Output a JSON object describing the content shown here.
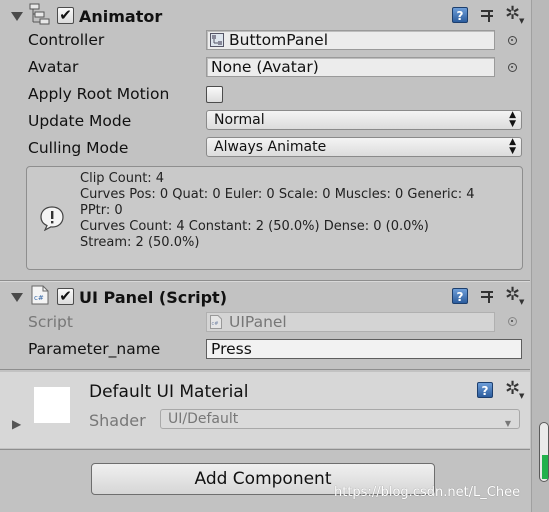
{
  "animator": {
    "title": "Animator",
    "enabled": true,
    "controller": {
      "label": "Controller",
      "value": "ButtomPanel"
    },
    "avatar": {
      "label": "Avatar",
      "value": "None (Avatar)"
    },
    "apply_root_motion": {
      "label": "Apply Root Motion",
      "checked": false
    },
    "update_mode": {
      "label": "Update Mode",
      "value": "Normal"
    },
    "culling_mode": {
      "label": "Culling Mode",
      "value": "Always Animate"
    },
    "info_lines": [
      "Clip Count: 4",
      "Curves Pos: 0 Quat: 0 Euler: 0 Scale: 0 Muscles: 0 Generic: 4",
      "PPtr: 0",
      "Curves Count: 4 Constant: 2 (50.0%) Dense: 0 (0.0%)",
      "Stream: 2 (50.0%)"
    ]
  },
  "ui_panel": {
    "title": "UI Panel (Script)",
    "enabled": true,
    "script": {
      "label": "Script",
      "value": "UIPanel"
    },
    "parameter_name": {
      "label": "Parameter_name",
      "value": "Press"
    }
  },
  "material": {
    "title": "Default UI Material",
    "shader_label": "Shader",
    "shader_value": "UI/Default"
  },
  "add_component_label": "Add Component",
  "watermark": "https://blog.csdn.net/L_Chee",
  "icons": {
    "check": "✔",
    "help": "?",
    "gear": "✲",
    "fold_open": "▼",
    "fold_closed": "▶"
  }
}
